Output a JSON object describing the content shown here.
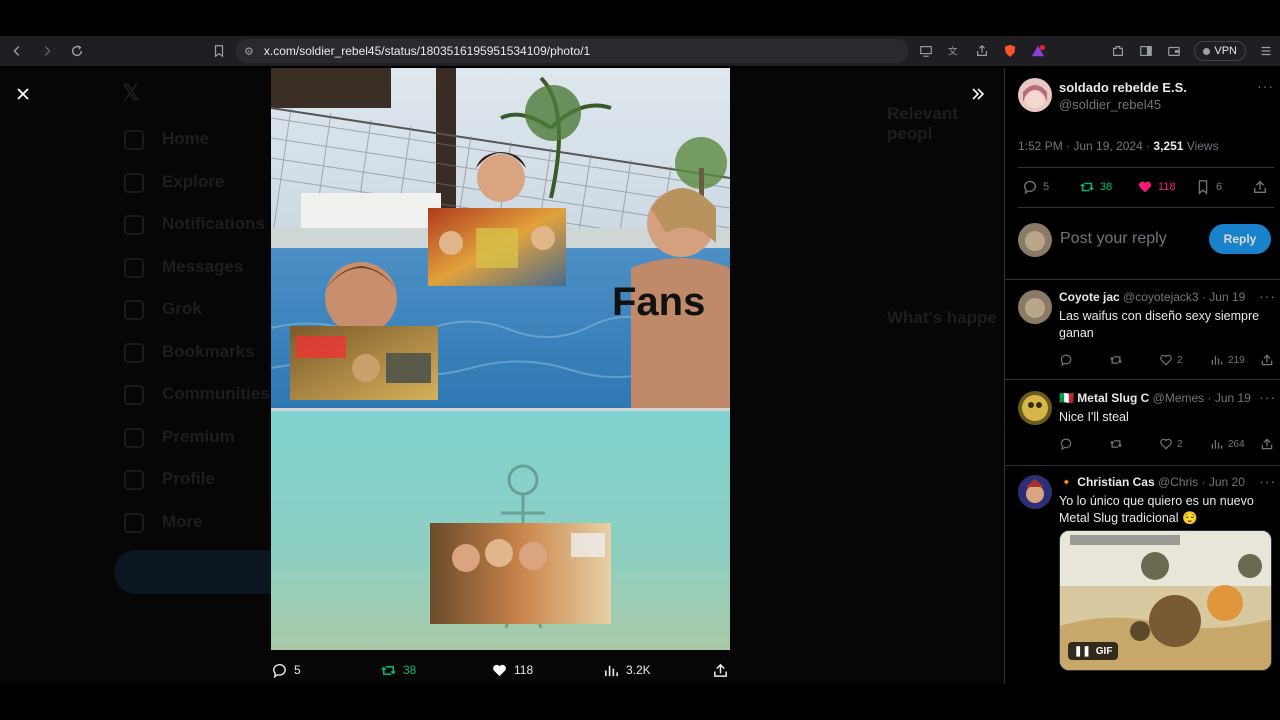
{
  "browser": {
    "url": "x.com/soldier_rebel45/status/1803516195951534109/photo/1",
    "vpn_label": "VPN",
    "badge_count": "1"
  },
  "background": {
    "nav_items": [
      "Home",
      "Explore",
      "Notifications",
      "Messages",
      "Grok",
      "Bookmarks",
      "Communities",
      "Premium",
      "Profile",
      "More"
    ]
  },
  "photo": {
    "caption_fans": "Fans"
  },
  "photo_actions": {
    "replies": "5",
    "reposts": "38",
    "likes": "118",
    "views": "3.2K"
  },
  "tweet": {
    "author_name": "soldado rebelde E.S.",
    "author_handle": "@soldier_rebel45",
    "time": "1:52 PM · Jun 19, 2024 · ",
    "views_count": "3,251",
    "views_label": " Views",
    "stats": {
      "replies": "5",
      "reposts": "38",
      "likes": "118",
      "bookmarks": "6"
    }
  },
  "reply_box": {
    "placeholder": "Post your reply",
    "button_label": "Reply"
  },
  "replies": [
    {
      "name": "Coyote jac",
      "handle": "@coyotejack3",
      "date": "· Jun 19",
      "text": "Las waifus con diseño sexy siempre ganan",
      "likes": "2",
      "views": "219"
    },
    {
      "flag": "🇮🇹",
      "name": "Metal Slug C",
      "handle": "@Memes",
      "date": "· Jun 19",
      "text": "Nice I'll steal",
      "likes": "2",
      "views": "264"
    },
    {
      "flag": "🔸",
      "name": "Christian Cas",
      "handle": "@Chris",
      "date": "· Jun 20",
      "text": "Yo lo único que quiero es un nuevo Metal Slug tradicional 😌",
      "gif_label": "GIF"
    }
  ],
  "colors": {
    "accent": "#1d9bf0",
    "repost": "#00ba7c",
    "like": "#f91880",
    "muted": "#71767b"
  }
}
